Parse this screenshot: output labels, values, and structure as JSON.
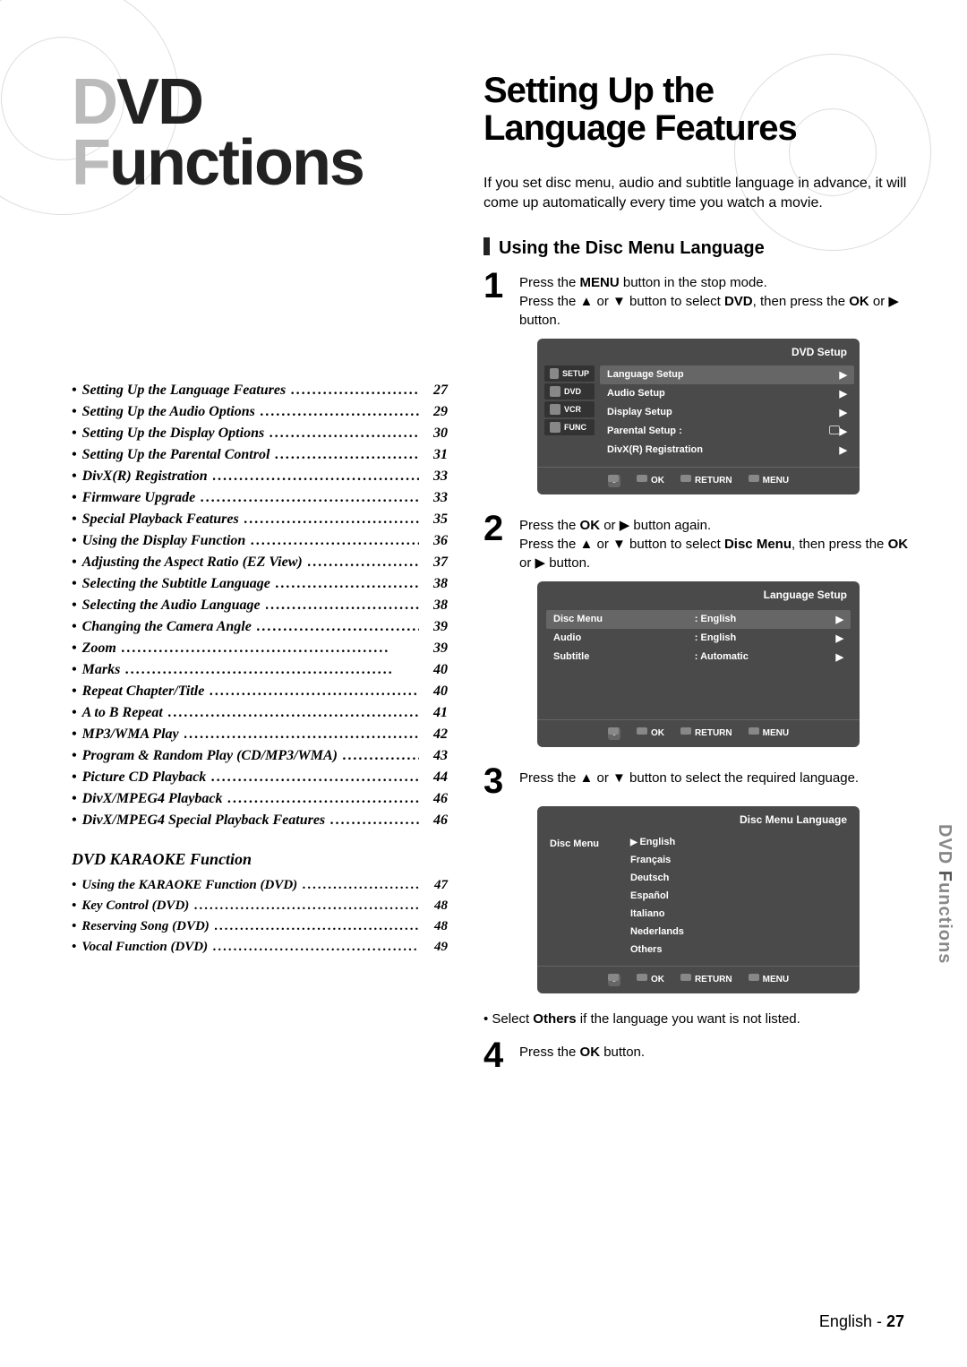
{
  "title_part1_faded": "D",
  "title_part1_rest": "VD",
  "title_part2_faded": "F",
  "title_part2_rest": "unctions",
  "toc": [
    {
      "label": "Setting Up the Language Features",
      "page": "27"
    },
    {
      "label": "Setting Up the Audio Options",
      "page": "29"
    },
    {
      "label": "Setting Up the Display Options",
      "page": "30"
    },
    {
      "label": "Setting Up the Parental Control",
      "page": "31"
    },
    {
      "label": "DivX(R) Registration",
      "page": "33"
    },
    {
      "label": "Firmware Upgrade",
      "page": "33"
    },
    {
      "label": "Special Playback Features",
      "page": "35"
    },
    {
      "label": "Using the Display Function",
      "page": "36"
    },
    {
      "label": "Adjusting the Aspect Ratio (EZ View)",
      "page": "37"
    },
    {
      "label": "Selecting the Subtitle Language",
      "page": "38"
    },
    {
      "label": "Selecting the Audio Language",
      "page": "38"
    },
    {
      "label": "Changing the Camera Angle",
      "page": "39"
    },
    {
      "label": "Zoom",
      "page": "39"
    },
    {
      "label": "Marks",
      "page": "40"
    },
    {
      "label": "Repeat Chapter/Title",
      "page": "40"
    },
    {
      "label": "A to B Repeat",
      "page": "41"
    },
    {
      "label": "MP3/WMA Play",
      "page": "42"
    },
    {
      "label": "Program & Random Play (CD/MP3/WMA)",
      "page": "43"
    },
    {
      "label": "Picture CD Playback",
      "page": "44"
    },
    {
      "label": "DivX/MPEG4 Playback",
      "page": "46"
    },
    {
      "label": "DivX/MPEG4 Special Playback Features",
      "page": "46"
    }
  ],
  "karaoke_heading": "DVD KARAOKE Function",
  "karaoke_toc": [
    {
      "label": "Using the KARAOKE Function (DVD)",
      "page": "47"
    },
    {
      "label": "Key Control (DVD)",
      "page": "48"
    },
    {
      "label": "Reserving Song (DVD)",
      "page": "48"
    },
    {
      "label": "Vocal Function (DVD)",
      "page": "49"
    }
  ],
  "section_title_l1": "Setting Up the",
  "section_title_l2": "Language Features",
  "intro": "If you set disc menu, audio and subtitle language in advance, it will come up automatically every time you watch a movie.",
  "subhead1": "Using the Disc Menu Language",
  "step1_num": "1",
  "step1_body_a": "Press the ",
  "step1_body_b": "MENU",
  "step1_body_c": " button in the stop mode.",
  "step1_body_d": "Press the ▲ or ▼ button to select ",
  "step1_body_e": "DVD",
  "step1_body_f": ", then press the ",
  "step1_body_g": "OK",
  "step1_body_h": " or ▶ button.",
  "osd1": {
    "title": "DVD  Setup",
    "side": [
      "SETUP",
      "DVD",
      "VCR",
      "FUNC"
    ],
    "rows": [
      {
        "label": "Language Setup",
        "hl": true
      },
      {
        "label": "Audio Setup"
      },
      {
        "label": "Display Setup"
      },
      {
        "label": "Parental Setup :",
        "lock": true
      },
      {
        "label": "DivX(R) Registration"
      }
    ],
    "footer": [
      "OK",
      "RETURN",
      "MENU"
    ]
  },
  "step2_num": "2",
  "step2_body_a": "Press the ",
  "step2_body_b": "OK",
  "step2_body_c": " or ▶ button again.",
  "step2_body_d": "Press the ▲ or ▼ button to select ",
  "step2_body_e": "Disc Menu",
  "step2_body_f": ", then press the ",
  "step2_body_g": "OK",
  "step2_body_h": " or ▶ button.",
  "osd2": {
    "title": "Language Setup",
    "rows": [
      {
        "label": "Disc Menu",
        "value": ": English",
        "hl": true
      },
      {
        "label": "Audio",
        "value": ": English"
      },
      {
        "label": "Subtitle",
        "value": ": Automatic"
      }
    ],
    "footer": [
      "OK",
      "RETURN",
      "MENU"
    ]
  },
  "step3_num": "3",
  "step3_body": "Press the ▲ or ▼ button to select the required language.",
  "osd3": {
    "title": "Disc Menu Language",
    "left_label": "Disc Menu",
    "langs": [
      {
        "label": "English",
        "hl": true
      },
      {
        "label": "Français"
      },
      {
        "label": "Deutsch"
      },
      {
        "label": "Español"
      },
      {
        "label": "Italiano"
      },
      {
        "label": "Nederlands"
      },
      {
        "label": "Others"
      }
    ],
    "footer": [
      "OK",
      "RETURN",
      "MENU"
    ]
  },
  "foot_note_a": "• Select ",
  "foot_note_b": "Others",
  "foot_note_c": " if the language you want is not listed.",
  "step4_num": "4",
  "step4_body_a": "Press the ",
  "step4_body_b": "OK",
  "step4_body_c": " button.",
  "page_foot_a": "English - ",
  "page_foot_b": "27",
  "side_tab_a": "DVD ",
  "side_tab_b": "F",
  "side_tab_c": "unctions"
}
